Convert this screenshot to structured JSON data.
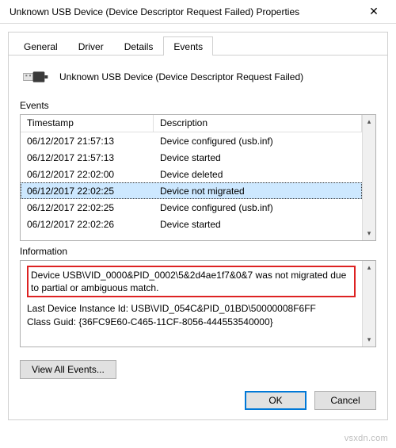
{
  "window": {
    "title": "Unknown USB Device (Device Descriptor Request Failed) Properties",
    "close_glyph": "✕"
  },
  "tabs": {
    "items": [
      "General",
      "Driver",
      "Details",
      "Events"
    ],
    "active_index": 3
  },
  "device": {
    "icon": "usb-plug-icon",
    "name": "Unknown USB Device (Device Descriptor Request Failed)"
  },
  "events": {
    "label": "Events",
    "headers": {
      "timestamp": "Timestamp",
      "description": "Description"
    },
    "rows": [
      {
        "timestamp": "06/12/2017 21:57:13",
        "description": "Device configured (usb.inf)"
      },
      {
        "timestamp": "06/12/2017 21:57:13",
        "description": "Device started"
      },
      {
        "timestamp": "06/12/2017 22:02:00",
        "description": "Device deleted"
      },
      {
        "timestamp": "06/12/2017 22:02:25",
        "description": "Device not migrated"
      },
      {
        "timestamp": "06/12/2017 22:02:25",
        "description": "Device configured (usb.inf)"
      },
      {
        "timestamp": "06/12/2017 22:02:26",
        "description": "Device started"
      }
    ],
    "selected_index": 3
  },
  "information": {
    "label": "Information",
    "highlighted": "Device USB\\VID_0000&PID_0002\\5&2d4ae1f7&0&7 was not migrated due to partial or ambiguous match.",
    "last_instance": "Last Device Instance Id: USB\\VID_054C&PID_01BD\\50000008F6FF",
    "class_guid": "Class Guid: {36FC9E60-C465-11CF-8056-444553540000}"
  },
  "buttons": {
    "view_all": "View All Events...",
    "ok": "OK",
    "cancel": "Cancel"
  },
  "watermark": "vsxdn.com"
}
